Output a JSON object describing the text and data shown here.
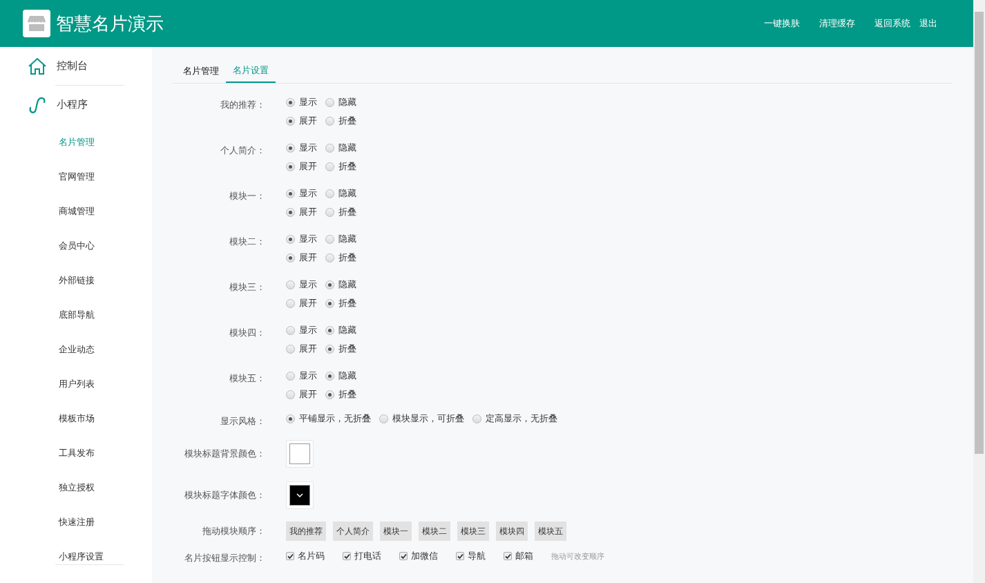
{
  "header": {
    "title": "智慧名片演示",
    "actions": [
      "一键换肤",
      "清理缓存",
      "返回系统",
      "退出"
    ]
  },
  "sidebar": {
    "top": [
      {
        "label": "控制台",
        "kind": "home"
      },
      {
        "label": "小程序",
        "kind": "miniapp"
      }
    ],
    "items": [
      {
        "label": "名片管理",
        "selected": true
      },
      {
        "label": "官网管理",
        "selected": false
      },
      {
        "label": "商城管理",
        "selected": false
      },
      {
        "label": "会员中心",
        "selected": false
      },
      {
        "label": "外部链接",
        "selected": false
      },
      {
        "label": "底部导航",
        "selected": false
      },
      {
        "label": "企业动态",
        "selected": false
      },
      {
        "label": "用户列表",
        "selected": false
      },
      {
        "label": "模板市场",
        "selected": false
      },
      {
        "label": "工具发布",
        "selected": false
      },
      {
        "label": "独立授权",
        "selected": false
      },
      {
        "label": "快速注册",
        "selected": false
      },
      {
        "label": "小程序设置",
        "selected": false
      }
    ]
  },
  "tabs": [
    {
      "label": "名片管理",
      "selected": false
    },
    {
      "label": "名片设置",
      "selected": true
    }
  ],
  "modules": [
    {
      "label": "我的推荐：",
      "groups": [
        [
          {
            "label": "显示",
            "selected": true
          },
          {
            "label": "隐藏",
            "selected": false
          }
        ],
        [
          {
            "label": "展开",
            "selected": true
          },
          {
            "label": "折叠",
            "selected": false
          }
        ]
      ]
    },
    {
      "label": "个人简介：",
      "groups": [
        [
          {
            "label": "显示",
            "selected": true
          },
          {
            "label": "隐藏",
            "selected": false
          }
        ],
        [
          {
            "label": "展开",
            "selected": true
          },
          {
            "label": "折叠",
            "selected": false
          }
        ]
      ]
    },
    {
      "label": "模块一：",
      "groups": [
        [
          {
            "label": "显示",
            "selected": true
          },
          {
            "label": "隐藏",
            "selected": false
          }
        ],
        [
          {
            "label": "展开",
            "selected": true
          },
          {
            "label": "折叠",
            "selected": false
          }
        ]
      ]
    },
    {
      "label": "模块二：",
      "groups": [
        [
          {
            "label": "显示",
            "selected": true
          },
          {
            "label": "隐藏",
            "selected": false
          }
        ],
        [
          {
            "label": "展开",
            "selected": true
          },
          {
            "label": "折叠",
            "selected": false
          }
        ]
      ]
    },
    {
      "label": "模块三：",
      "groups": [
        [
          {
            "label": "显示",
            "selected": false
          },
          {
            "label": "隐藏",
            "selected": true
          }
        ],
        [
          {
            "label": "展开",
            "selected": false
          },
          {
            "label": "折叠",
            "selected": true
          }
        ]
      ]
    },
    {
      "label": "模块四：",
      "groups": [
        [
          {
            "label": "显示",
            "selected": false
          },
          {
            "label": "隐藏",
            "selected": true
          }
        ],
        [
          {
            "label": "展开",
            "selected": false
          },
          {
            "label": "折叠",
            "selected": true
          }
        ]
      ]
    },
    {
      "label": "模块五：",
      "groups": [
        [
          {
            "label": "显示",
            "selected": false
          },
          {
            "label": "隐藏",
            "selected": true
          }
        ],
        [
          {
            "label": "展开",
            "selected": false
          },
          {
            "label": "折叠",
            "selected": true
          }
        ]
      ]
    }
  ],
  "style": {
    "label": "显示风格：",
    "options": [
      {
        "label": "平铺显示，无折叠",
        "selected": true
      },
      {
        "label": "模块显示，可折叠",
        "selected": false
      },
      {
        "label": "定高显示，无折叠",
        "selected": false
      }
    ]
  },
  "colors": [
    {
      "label": "模块标题背景颜色：",
      "color": "#ffffff",
      "open": false
    },
    {
      "label": "模块标题字体颜色：",
      "color": "#000000",
      "open": true
    }
  ],
  "order": {
    "label": "拖动模块顺序：",
    "items": [
      "我的推荐",
      "个人简介",
      "模块一",
      "模块二",
      "模块三",
      "模块四",
      "模块五"
    ]
  },
  "buttons": {
    "label": "名片按钮显示控制：",
    "items": [
      {
        "label": "名片码",
        "checked": true
      },
      {
        "label": "打电话",
        "checked": true
      },
      {
        "label": "加微信",
        "checked": true
      },
      {
        "label": "导航",
        "checked": true
      },
      {
        "label": "邮箱",
        "checked": true
      }
    ],
    "hint": "拖动可改变顺序"
  }
}
